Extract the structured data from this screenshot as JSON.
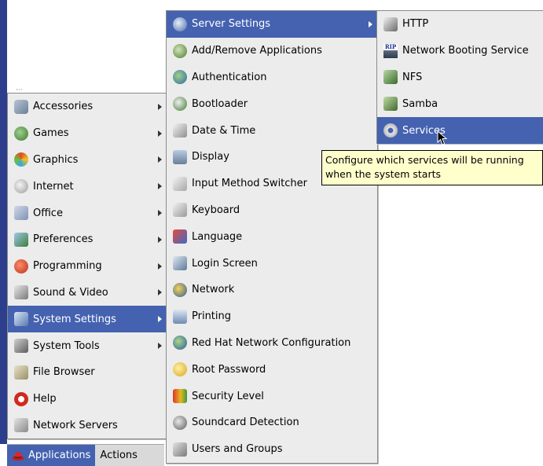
{
  "panel": {
    "applications_label": "Applications",
    "actions_label": "Actions"
  },
  "main_menu": [
    {
      "label": "Accessories",
      "icon": "accessories-icon",
      "submenu": true
    },
    {
      "label": "Games",
      "icon": "games-icon",
      "submenu": true
    },
    {
      "label": "Graphics",
      "icon": "graphics-icon",
      "submenu": true
    },
    {
      "label": "Internet",
      "icon": "internet-icon",
      "submenu": true
    },
    {
      "label": "Office",
      "icon": "office-icon",
      "submenu": true
    },
    {
      "label": "Preferences",
      "icon": "preferences-icon",
      "submenu": true
    },
    {
      "label": "Programming",
      "icon": "programming-icon",
      "submenu": true
    },
    {
      "label": "Sound & Video",
      "icon": "sound-video-icon",
      "submenu": true
    },
    {
      "label": "System Settings",
      "icon": "system-settings-icon",
      "submenu": true,
      "selected": true
    },
    {
      "label": "System Tools",
      "icon": "system-tools-icon",
      "submenu": true
    },
    {
      "label": "File Browser",
      "icon": "file-browser-icon",
      "submenu": false
    },
    {
      "label": "Help",
      "icon": "help-icon",
      "submenu": false
    },
    {
      "label": "Network Servers",
      "icon": "network-servers-icon",
      "submenu": false
    }
  ],
  "system_settings_menu": [
    {
      "label": "Server Settings",
      "icon": "server-settings-icon",
      "submenu": true,
      "selected": true
    },
    {
      "label": "Add/Remove Applications",
      "icon": "add-remove-icon"
    },
    {
      "label": "Authentication",
      "icon": "authentication-icon"
    },
    {
      "label": "Bootloader",
      "icon": "bootloader-icon"
    },
    {
      "label": "Date & Time",
      "icon": "date-time-icon"
    },
    {
      "label": "Display",
      "icon": "display-icon"
    },
    {
      "label": "Input Method Switcher",
      "icon": "input-method-icon"
    },
    {
      "label": "Keyboard",
      "icon": "keyboard-icon"
    },
    {
      "label": "Language",
      "icon": "language-icon"
    },
    {
      "label": "Login Screen",
      "icon": "login-screen-icon"
    },
    {
      "label": "Network",
      "icon": "network-icon"
    },
    {
      "label": "Printing",
      "icon": "printing-icon"
    },
    {
      "label": "Red Hat Network Configuration",
      "icon": "red-hat-network-icon"
    },
    {
      "label": "Root Password",
      "icon": "root-password-icon"
    },
    {
      "label": "Security Level",
      "icon": "security-level-icon"
    },
    {
      "label": "Soundcard Detection",
      "icon": "soundcard-icon"
    },
    {
      "label": "Users and Groups",
      "icon": "users-groups-icon"
    }
  ],
  "server_settings_menu": [
    {
      "label": "HTTP",
      "icon": "http-icon"
    },
    {
      "label": "Network Booting Service",
      "icon": "network-booting-icon"
    },
    {
      "label": "NFS",
      "icon": "nfs-icon"
    },
    {
      "label": "Samba",
      "icon": "samba-icon"
    },
    {
      "label": "Services",
      "icon": "services-icon",
      "selected": true
    }
  ],
  "tooltip": {
    "line1": "Configure which services will be running",
    "line2": "when the system starts"
  },
  "icon_badges": {
    "network_booting": "RIP"
  },
  "colors": {
    "selection": "#4462b0",
    "menu_bg": "#ececec",
    "tooltip_bg": "#ffffcc",
    "desktop_edge": "#2d3e8c"
  }
}
